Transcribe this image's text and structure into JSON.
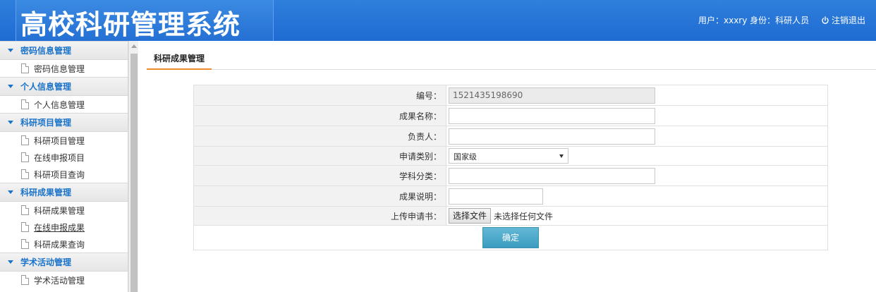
{
  "header": {
    "title": "高校科研管理系统",
    "user_info": "用户：xxxry 身份：科研人员",
    "logout_label": "注销退出"
  },
  "sidebar": {
    "groups": [
      {
        "label": "密码信息管理",
        "items": [
          {
            "label": "密码信息管理"
          }
        ]
      },
      {
        "label": "个人信息管理",
        "items": [
          {
            "label": "个人信息管理"
          }
        ]
      },
      {
        "label": "科研项目管理",
        "items": [
          {
            "label": "科研项目管理"
          },
          {
            "label": "在线申报项目"
          },
          {
            "label": "科研项目查询"
          }
        ]
      },
      {
        "label": "科研成果管理",
        "items": [
          {
            "label": "科研成果管理"
          },
          {
            "label": "在线申报成果"
          },
          {
            "label": "科研成果查询"
          }
        ]
      },
      {
        "label": "学术活动管理",
        "items": [
          {
            "label": "学术活动管理"
          }
        ]
      }
    ]
  },
  "main": {
    "tab_label": "科研成果管理",
    "form": {
      "id_label": "编号：",
      "id_value": "1521435198690",
      "name_label": "成果名称：",
      "owner_label": "负责人：",
      "category_label": "申请类别：",
      "category_value": "国家级",
      "subject_label": "学科分类：",
      "desc_label": "成果说明：",
      "upload_label": "上传申请书：",
      "upload_button": "选择文件",
      "upload_status": "未选择任何文件",
      "submit_label": "确定"
    }
  }
}
